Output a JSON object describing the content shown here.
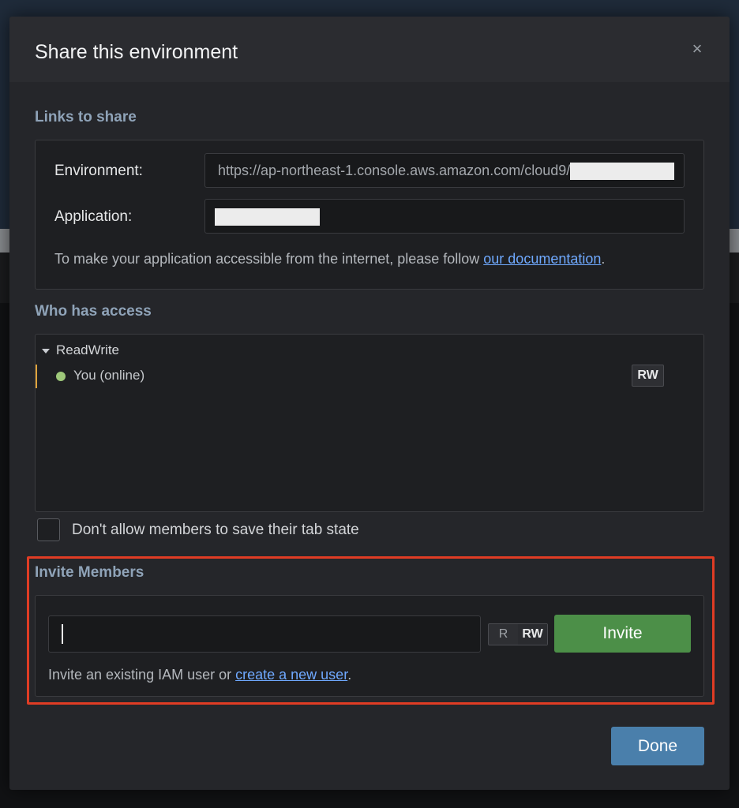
{
  "modal": {
    "title": "Share this environment",
    "close_label": "×"
  },
  "links": {
    "section_title": "Links to share",
    "environment_label": "Environment:",
    "environment_url": "https://ap-northeast-1.console.aws.amazon.com/cloud9/",
    "application_label": "Application:",
    "help_prefix": "To make your application accessible from the internet, please follow ",
    "help_link": "our documentation",
    "help_suffix": "."
  },
  "access": {
    "section_title": "Who has access",
    "group_label": "ReadWrite",
    "members": [
      {
        "name": "You (online)",
        "permission": "RW",
        "status_color": "#9ec87a"
      }
    ],
    "tab_state_label": "Don't allow members to save their tab state"
  },
  "invite": {
    "section_title": "Invite Members",
    "input_value": "",
    "perm_r": "R",
    "perm_rw": "RW",
    "button_label": "Invite",
    "help_prefix": "Invite an existing IAM user or ",
    "help_link": "create a new user",
    "help_suffix": "."
  },
  "footer": {
    "done_label": "Done"
  },
  "colors": {
    "accent_green": "#4c8f48",
    "accent_blue": "#4a7fab",
    "highlight_red": "#e03c24",
    "link_blue": "#6fa9ff"
  }
}
